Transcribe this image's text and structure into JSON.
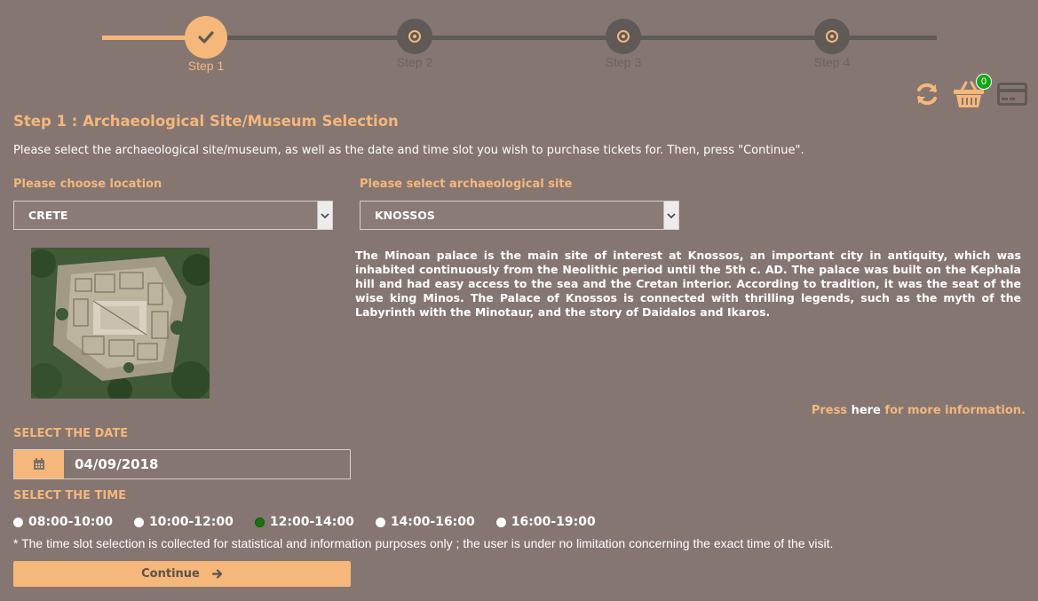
{
  "stepper": {
    "steps": [
      {
        "label": "Step 1",
        "state": "active"
      },
      {
        "label": "Step 2",
        "state": "pending"
      },
      {
        "label": "Step 3",
        "state": "pending"
      },
      {
        "label": "Step 4",
        "state": "pending"
      }
    ]
  },
  "toolbar": {
    "refresh_icon": "refresh-icon",
    "cart_icon": "basket-icon",
    "cart_count": "0",
    "payment_icon": "credit-card-icon"
  },
  "page": {
    "title": "Step 1 : Archaeological Site/Museum Selection",
    "intro": "Please select the archaeological site/museum, as well as the date and time slot you wish to purchase tickets for. Then, press \"Continue\"."
  },
  "location": {
    "label": "Please choose location",
    "selected": "CRETE"
  },
  "site": {
    "label": "Please select archaeological site",
    "selected": "KNOSSOS",
    "description": "The Minoan palace is the main site of interest at Knossos, an important city in antiquity, which was inhabited continuously from the Neolithic period until the 5th c. AD. The palace was built on the Kephala hill and had easy access to the sea and the Cretan interior. According to tradition, it was the seat of the wise king Minos. The Palace of Knossos is connected with thrilling legends, such as the myth of the Labyrinth with the Minotaur, and the story of Daidalos and Ikaros.",
    "more_prefix": "Press",
    "more_link": "here",
    "more_suffix": "for more information."
  },
  "date": {
    "label": "SELECT THE DATE",
    "value": "04/09/2018",
    "icon": "calendar-icon"
  },
  "time": {
    "label": "SELECT THE TIME",
    "slots": [
      {
        "label": "08:00-10:00",
        "checked": false
      },
      {
        "label": "10:00-12:00",
        "checked": false
      },
      {
        "label": "12:00-14:00",
        "checked": true
      },
      {
        "label": "14:00-16:00",
        "checked": false
      },
      {
        "label": "16:00-19:00",
        "checked": false
      }
    ],
    "note": "* The time slot selection is collected for statistical and information purposes only ; the user is under no limitation concerning the exact time of the visit."
  },
  "actions": {
    "continue_label": "Continue",
    "continue_icon": "arrow-right-icon"
  },
  "colors": {
    "background": "#857672",
    "accent": "#f5b77a",
    "inactive": "#5f5a58",
    "badge": "#14a614",
    "selected_radio": "#137313"
  }
}
